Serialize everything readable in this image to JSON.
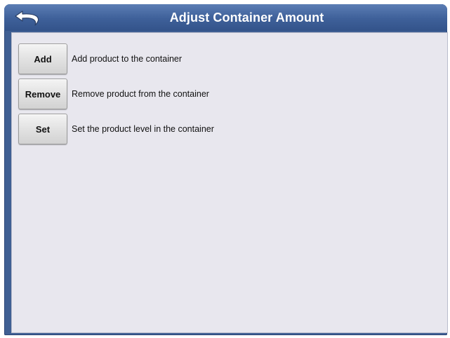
{
  "window": {
    "title": "Adjust Container Amount",
    "back_icon": "back-arrow-icon"
  },
  "options": [
    {
      "label": "Add",
      "description": "Add product to the container"
    },
    {
      "label": "Remove",
      "description": "Remove product from the container"
    },
    {
      "label": "Set",
      "description": "Set the product level in the container"
    }
  ],
  "colors": {
    "titlebar": "#3e6099",
    "content_background": "#e8e7ee",
    "button_face": "#e2e2e2"
  }
}
